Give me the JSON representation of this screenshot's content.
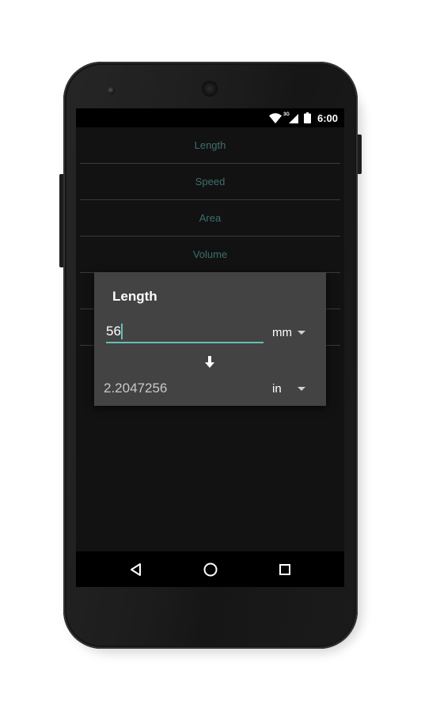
{
  "status_bar": {
    "network_label": "3G",
    "time": "6:00"
  },
  "categories": [
    {
      "label": "Length"
    },
    {
      "label": "Speed"
    },
    {
      "label": "Area"
    },
    {
      "label": "Volume"
    },
    {
      "label": ""
    },
    {
      "label": ""
    }
  ],
  "dialog": {
    "title": "Length",
    "input_value": "56",
    "from_unit": "mm",
    "result_value": "2.2047256",
    "to_unit": "in"
  },
  "colors": {
    "accent": "#63c1b6",
    "category_text": "#3d6f6c",
    "dialog_background": "#434343",
    "screen_background": "#121212"
  },
  "icons": {
    "wifi": "wifi-icon",
    "signal": "signal-icon",
    "battery": "battery-icon",
    "arrow": "arrow-down-icon",
    "back": "back-icon",
    "home": "home-icon",
    "recent": "recent-apps-icon"
  }
}
